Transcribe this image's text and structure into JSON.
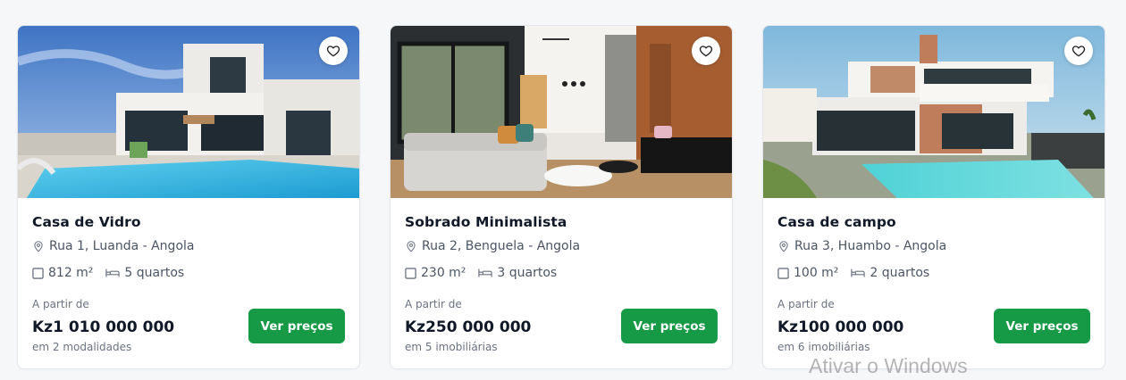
{
  "listings": [
    {
      "title": "Casa de Vidro",
      "address": "Rua 1, Luanda - Angola",
      "area": "812 m²",
      "rooms": "5 quartos",
      "from_label": "A partir de",
      "price": "Kz1 010 000 000",
      "subtext": "em 2 modalidades",
      "button_label": "Ver preços",
      "photo": "modern white villa with pool"
    },
    {
      "title": "Sobrado Minimalista",
      "address": "Rua 2, Benguela - Angola",
      "area": "230 m²",
      "rooms": "3 quartos",
      "from_label": "A partir de",
      "price": "Kz250 000 000",
      "subtext": "em 5 imobiliárias",
      "button_label": "Ver preços",
      "photo": "minimalist living room interior"
    },
    {
      "title": "Casa de campo",
      "address": "Rua 3, Huambo - Angola",
      "area": "100 m²",
      "rooms": "2 quartos",
      "from_label": "A partir de",
      "price": "Kz100 000 000",
      "subtext": "em 6 imobiliárias",
      "button_label": "Ver preços",
      "photo": "country house with pool"
    }
  ],
  "icons": {
    "favorite": "heart-icon",
    "location": "map-pin-icon",
    "area": "square-icon",
    "rooms": "bed-icon"
  },
  "colors": {
    "primary_button": "#169a46",
    "page_background": "#f6f7f9",
    "card_background": "#ffffff"
  },
  "watermark": "Ativar o Windows"
}
